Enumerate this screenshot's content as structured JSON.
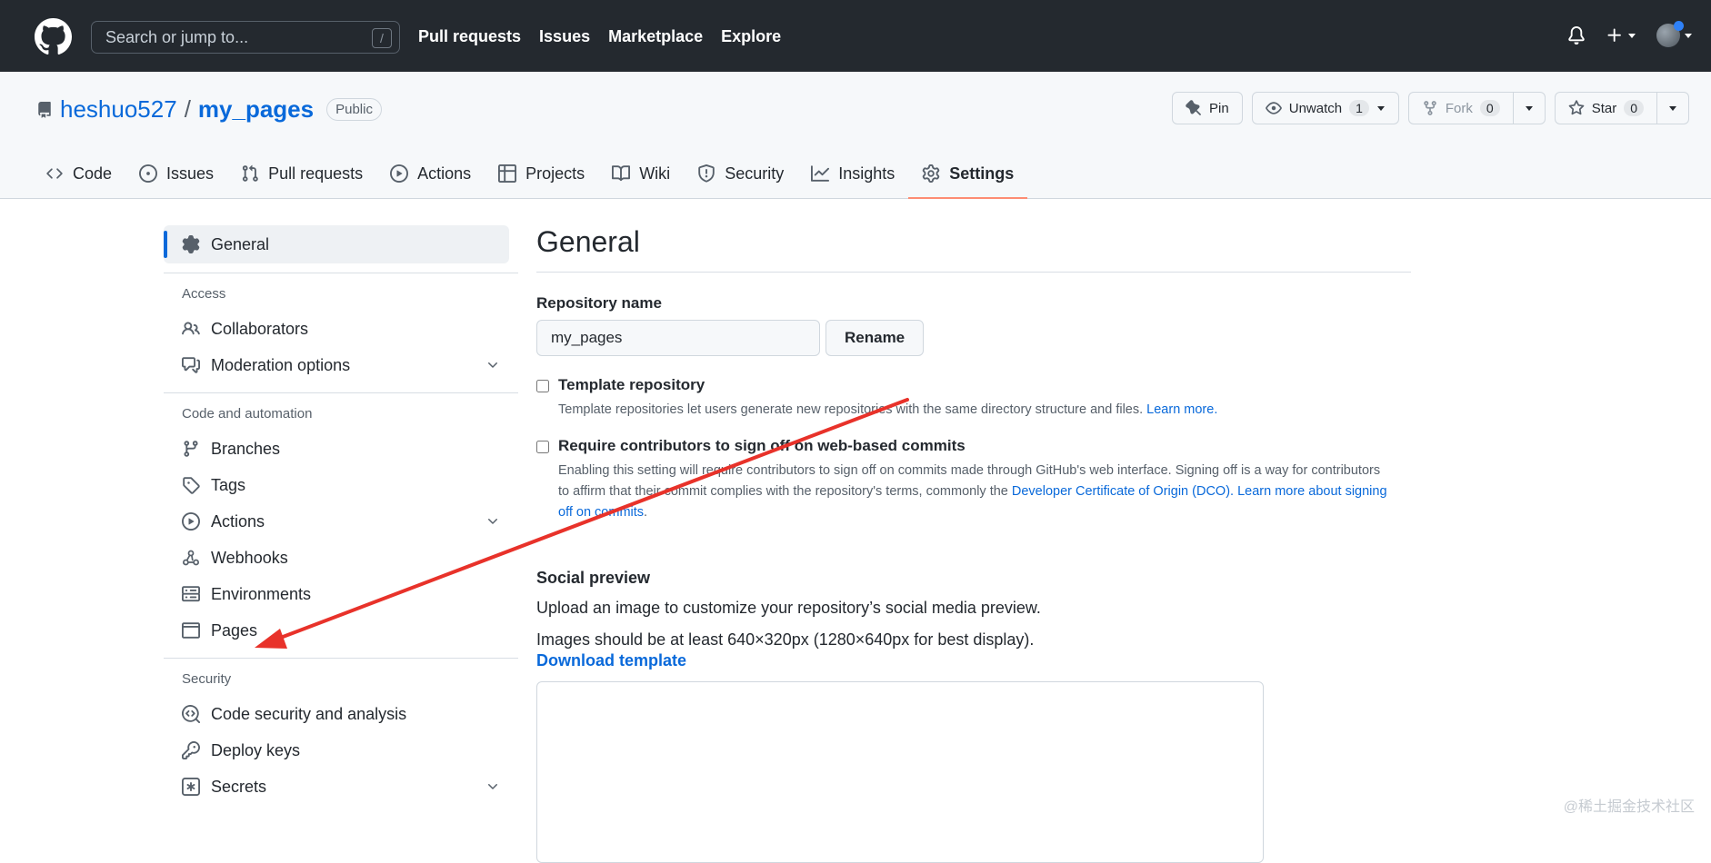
{
  "topbar": {
    "search_placeholder": "Search or jump to...",
    "search_key": "/",
    "nav": [
      "Pull requests",
      "Issues",
      "Marketplace",
      "Explore"
    ]
  },
  "repo": {
    "owner": "heshuo527",
    "separator": "/",
    "name": "my_pages",
    "visibility": "Public",
    "pin_label": "Pin",
    "unwatch_label": "Unwatch",
    "watch_count": "1",
    "fork_label": "Fork",
    "fork_count": "0",
    "star_label": "Star",
    "star_count": "0"
  },
  "tabs": [
    "Code",
    "Issues",
    "Pull requests",
    "Actions",
    "Projects",
    "Wiki",
    "Security",
    "Insights",
    "Settings"
  ],
  "sidebar": {
    "general": "General",
    "access_heading": "Access",
    "access_items": [
      "Collaborators",
      "Moderation options"
    ],
    "code_heading": "Code and automation",
    "code_items": [
      "Branches",
      "Tags",
      "Actions",
      "Webhooks",
      "Environments",
      "Pages"
    ],
    "security_heading": "Security",
    "security_items": [
      "Code security and analysis",
      "Deploy keys",
      "Secrets"
    ]
  },
  "main": {
    "title": "General",
    "repo_name_label": "Repository name",
    "repo_name_value": "my_pages",
    "rename_label": "Rename",
    "template_title": "Template repository",
    "template_desc": "Template repositories let users generate new repositories with the same directory structure and files.",
    "learn_more": "Learn more.",
    "signoff_title": "Require contributors to sign off on web-based commits",
    "signoff_desc": "Enabling this setting will require contributors to sign off on commits made through GitHub's web interface. Signing off is a way for contributors to affirm that their commit complies with the repository's terms, commonly the",
    "dco_link": "Developer Certificate of Origin (DCO).",
    "signoff_learn": "Learn more about signing off on commits",
    "social_title": "Social preview",
    "social_desc": "Upload an image to customize your repository’s social media preview.",
    "social_size": "Images should be at least 640×320px (1280×640px for best display).",
    "download_template": "Download template"
  },
  "watermark": "@稀土掘金技术社区",
  "colors": {
    "header_bg": "#24292f",
    "link": "#0969da",
    "selected_underline": "#fd8c73",
    "annotation_arrow": "#e8322a"
  }
}
